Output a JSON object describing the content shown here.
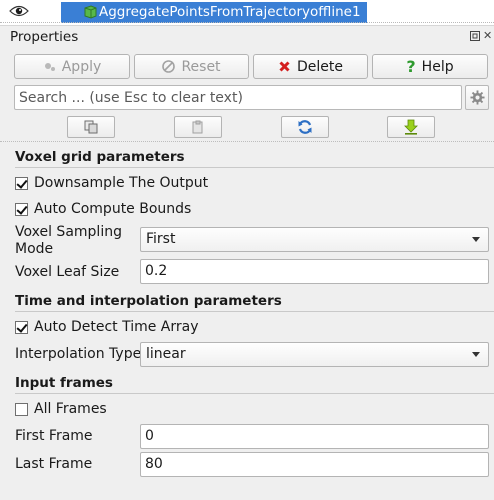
{
  "pipeline": {
    "item_label": "AggregatePointsFromTrajectoryoffline1"
  },
  "panel": {
    "title": "Properties"
  },
  "toolbar": {
    "apply_label": "Apply",
    "reset_label": "Reset",
    "delete_label": "Delete",
    "help_label": "Help"
  },
  "search": {
    "placeholder": "Search ... (use Esc to clear text)"
  },
  "sections": {
    "voxel": {
      "title": "Voxel grid parameters",
      "downsample_label": "Downsample The Output",
      "downsample_checked": true,
      "auto_bounds_label": "Auto Compute Bounds",
      "auto_bounds_checked": true,
      "sampling_mode_label_line1": "Voxel Sampling",
      "sampling_mode_label_line2": "Mode",
      "sampling_mode_value": "First",
      "leaf_size_label": "Voxel Leaf Size",
      "leaf_size_value": "0.2"
    },
    "time": {
      "title": "Time and interpolation parameters",
      "auto_time_label": "Auto Detect Time Array",
      "auto_time_checked": true,
      "interp_label": "Interpolation Type",
      "interp_value": "linear"
    },
    "frames": {
      "title": "Input frames",
      "all_frames_label": "All Frames",
      "all_frames_checked": false,
      "first_label": "First Frame",
      "first_value": "0",
      "last_label": "Last Frame",
      "last_value": "80"
    }
  },
  "colors": {
    "selection": "#3a7fd5",
    "delete_icon": "#d42020",
    "help_icon": "#2e9a2e",
    "reload_icon": "#2d6fc4",
    "download_icon": "#9ad11c"
  }
}
